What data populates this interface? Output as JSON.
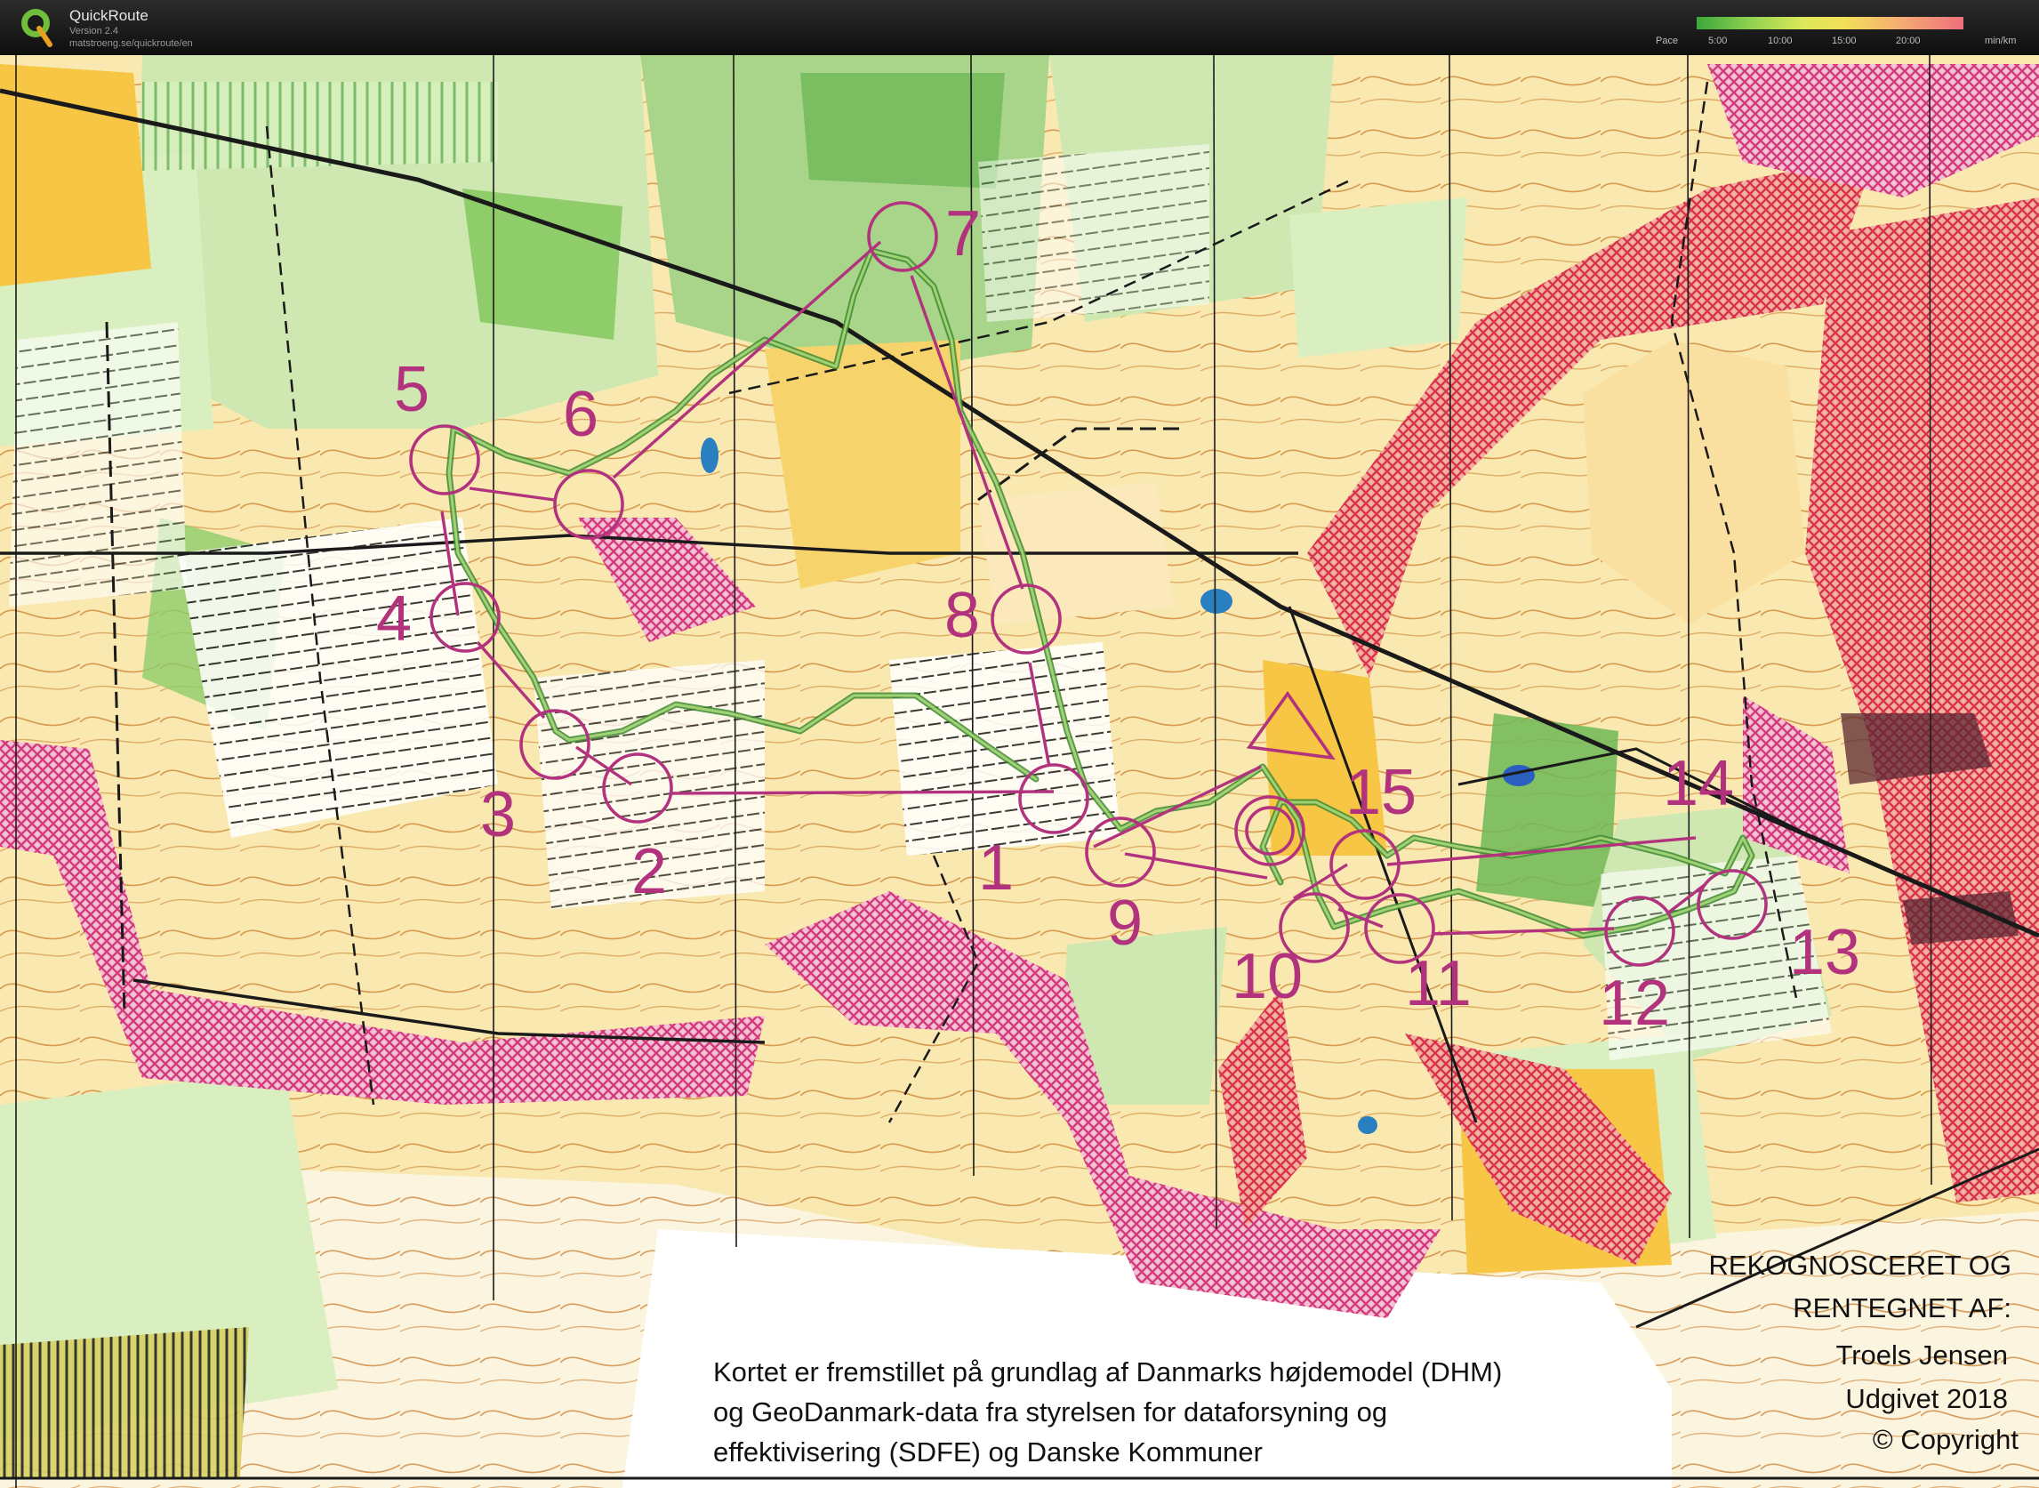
{
  "app": {
    "name": "QuickRoute",
    "version": "Version 2.4",
    "url": "matstroeng.se/quickroute/en"
  },
  "pace_legend": {
    "label": "Pace",
    "ticks": [
      "5:00",
      "10:00",
      "15:00",
      "20:00"
    ],
    "unit": "min/km"
  },
  "controls": [
    {
      "label": "1"
    },
    {
      "label": "2"
    },
    {
      "label": "3"
    },
    {
      "label": "4"
    },
    {
      "label": "5"
    },
    {
      "label": "6"
    },
    {
      "label": "7"
    },
    {
      "label": "8"
    },
    {
      "label": "9"
    },
    {
      "label": "10"
    },
    {
      "label": "11"
    },
    {
      "label": "12"
    },
    {
      "label": "13"
    },
    {
      "label": "14"
    },
    {
      "label": "15"
    }
  ],
  "map_text": {
    "credit_lines": [
      "REKOGNOSCERET OG",
      "RENTEGNET AF:",
      "Troels Jensen",
      "Udgivet 2018",
      "© Copyright"
    ],
    "disclaimer_lines": [
      "Kortet er fremstillet på grundlag af Danmarks højdemodel (DHM)",
      "og GeoDanmark-data fra styrelsen for dataforsyning og",
      "effektivisering (SDFE) og Danske Kommuner"
    ]
  },
  "colors": {
    "course": "#b2327e",
    "open_land": "#f7d36b",
    "forest_green": "#6fb857",
    "light_green": "#c7e3a5",
    "out_of_bounds": "#d33c7e",
    "water": "#2a7fc0",
    "contour": "#c97a2a"
  }
}
